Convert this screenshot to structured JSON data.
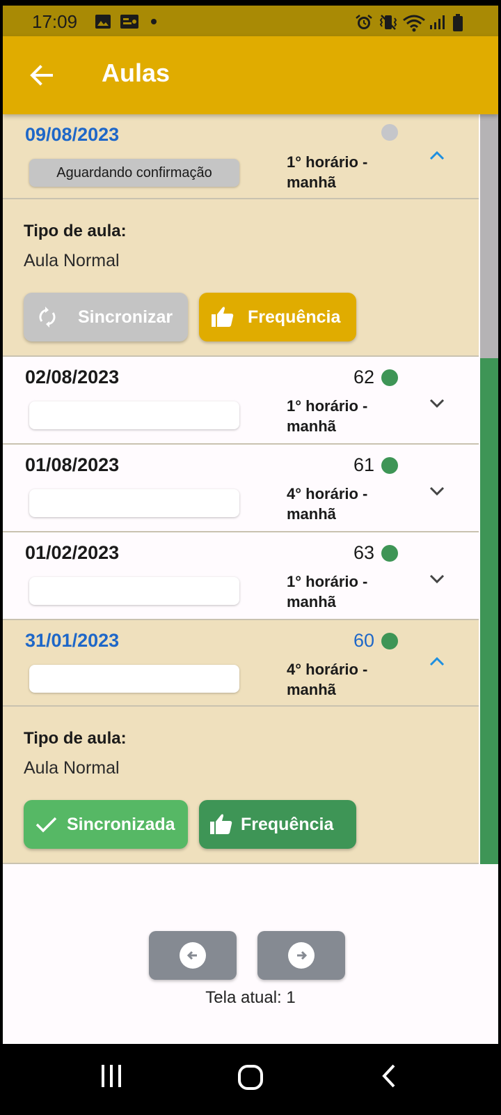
{
  "status_bar": {
    "time": "17:09",
    "left_icons": [
      "image-icon",
      "contact-card-icon",
      "notification-dot-icon"
    ],
    "right_icons": [
      "alarm-icon",
      "vibrate-icon",
      "wifi-icon",
      "signal-icon",
      "battery-icon"
    ]
  },
  "app_bar": {
    "title": "Aulas",
    "back_icon": "arrow-left-icon"
  },
  "lessons": [
    {
      "date": "09/08/2023",
      "count": "",
      "status_color": "grey",
      "badge": "Aguardando confirmação",
      "slot_line1": "1° horário -",
      "slot_line2": "manhã",
      "expanded": true,
      "detail": {
        "type_label": "Tipo de aula:",
        "type_value": "Aula Normal",
        "sync_label": "Sincronizar",
        "freq_label": "Frequência"
      }
    },
    {
      "date": "02/08/2023",
      "count": "62",
      "status_color": "green",
      "badge": "",
      "slot_line1": "1° horário -",
      "slot_line2": "manhã",
      "expanded": false
    },
    {
      "date": "01/08/2023",
      "count": "61",
      "status_color": "green",
      "badge": "",
      "slot_line1": "4° horário -",
      "slot_line2": "manhã",
      "expanded": false
    },
    {
      "date": "01/02/2023",
      "count": "63",
      "status_color": "green",
      "badge": "",
      "slot_line1": "1° horário -",
      "slot_line2": "manhã",
      "expanded": false
    },
    {
      "date": "31/01/2023",
      "count": "60",
      "status_color": "green",
      "badge": "",
      "slot_line1": "4° horário -",
      "slot_line2": "manhã",
      "expanded": true,
      "detail": {
        "type_label": "Tipo de aula:",
        "type_value": "Aula Normal",
        "sync_label": "Sincronizada",
        "freq_label": "Frequência"
      }
    }
  ],
  "pagination": {
    "prev_icon": "arrow-left-circle-icon",
    "next_icon": "arrow-right-circle-icon",
    "page_info": "Tela atual: 1"
  },
  "colors": {
    "status_bar": "#a98a05",
    "app_bar": "#e0ac00",
    "expanded_row": "#efe0bd",
    "date_blue": "#1e67c8",
    "green": "#3e9556",
    "green_light": "#56b865",
    "grey_button": "#c4c4c4",
    "pager_button": "#858a92"
  },
  "nav_bar": {
    "icons": [
      "recent-apps-icon",
      "home-icon",
      "back-icon"
    ]
  }
}
